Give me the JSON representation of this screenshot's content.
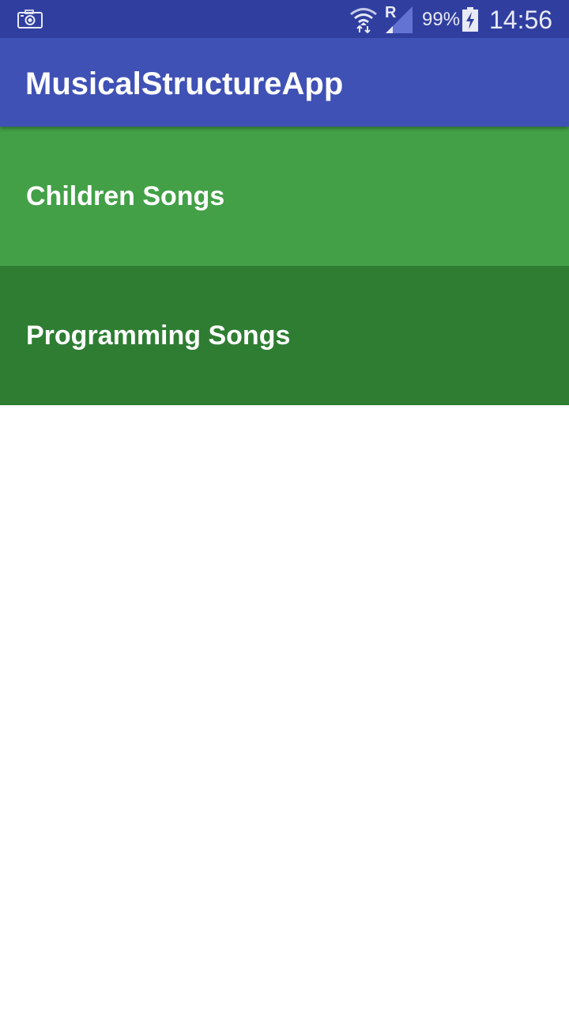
{
  "status_bar": {
    "left_icons": [
      "screenshot-icon"
    ],
    "right_icons": [
      "wifi-icon",
      "signal-icon",
      "battery-charging-icon"
    ],
    "roaming_indicator": "R",
    "battery_percent": "99%",
    "time": "14:56",
    "background_color": "#303f9f"
  },
  "app_bar": {
    "title": "MusicalStructureApp",
    "background_color": "#3f51b5"
  },
  "categories": [
    {
      "label": "Children Songs",
      "color": "#43a047"
    },
    {
      "label": "Programming Songs",
      "color": "#2e7d32"
    }
  ]
}
